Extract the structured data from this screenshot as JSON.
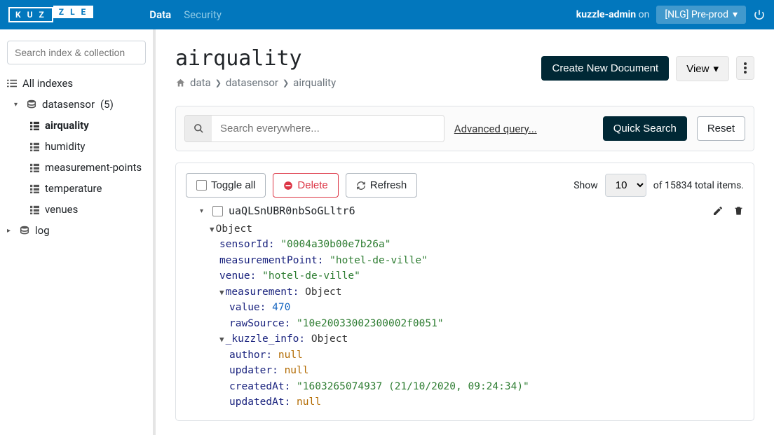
{
  "nav": {
    "links": [
      "Data",
      "Security"
    ],
    "user": "kuzzle-admin",
    "on": "on",
    "env": "[NLG] Pre-prod"
  },
  "sidebar": {
    "search_placeholder": "Search index & collection",
    "all_indexes": "All indexes",
    "index_name": "datasensor",
    "index_count": "(5)",
    "collections": [
      "airquality",
      "humidity",
      "measurement-points",
      "temperature",
      "venues"
    ],
    "log": "log"
  },
  "page": {
    "title": "airquality",
    "breadcrumb": [
      "data",
      "datasensor",
      "airquality"
    ]
  },
  "actions": {
    "create": "Create New Document",
    "view": "View"
  },
  "search": {
    "placeholder": "Search everywhere...",
    "advanced": "Advanced query...",
    "quick": "Quick Search",
    "reset": "Reset"
  },
  "toolbar": {
    "toggle_all": "Toggle all",
    "delete": "Delete",
    "refresh": "Refresh",
    "show": "Show",
    "per_page": "10",
    "of_total_pre": "of ",
    "total": "15834",
    "of_total_post": " total items."
  },
  "doc": {
    "id": "uaQLSnUBR0nbSoGLltr6",
    "object_label": "Object",
    "fields": {
      "sensorId_key": "sensorId",
      "sensorId_val": "\"0004a30b00e7b26a\"",
      "measurementPoint_key": "measurementPoint",
      "measurementPoint_val": "\"hotel-de-ville\"",
      "venue_key": "venue",
      "venue_val": "\"hotel-de-ville\"",
      "measurement_key": "measurement",
      "value_key": "value",
      "value_val": "470",
      "rawSource_key": "rawSource",
      "rawSource_val": "\"10e20033002300002f0051\"",
      "kuzzle_info_key": "_kuzzle_info",
      "author_key": "author",
      "author_val": "null",
      "updater_key": "updater",
      "updater_val": "null",
      "createdAt_key": "createdAt",
      "createdAt_val": "\"1603265074937 (21/10/2020, 09:24:34)\"",
      "updatedAt_key": "updatedAt",
      "updatedAt_val": "null"
    }
  }
}
